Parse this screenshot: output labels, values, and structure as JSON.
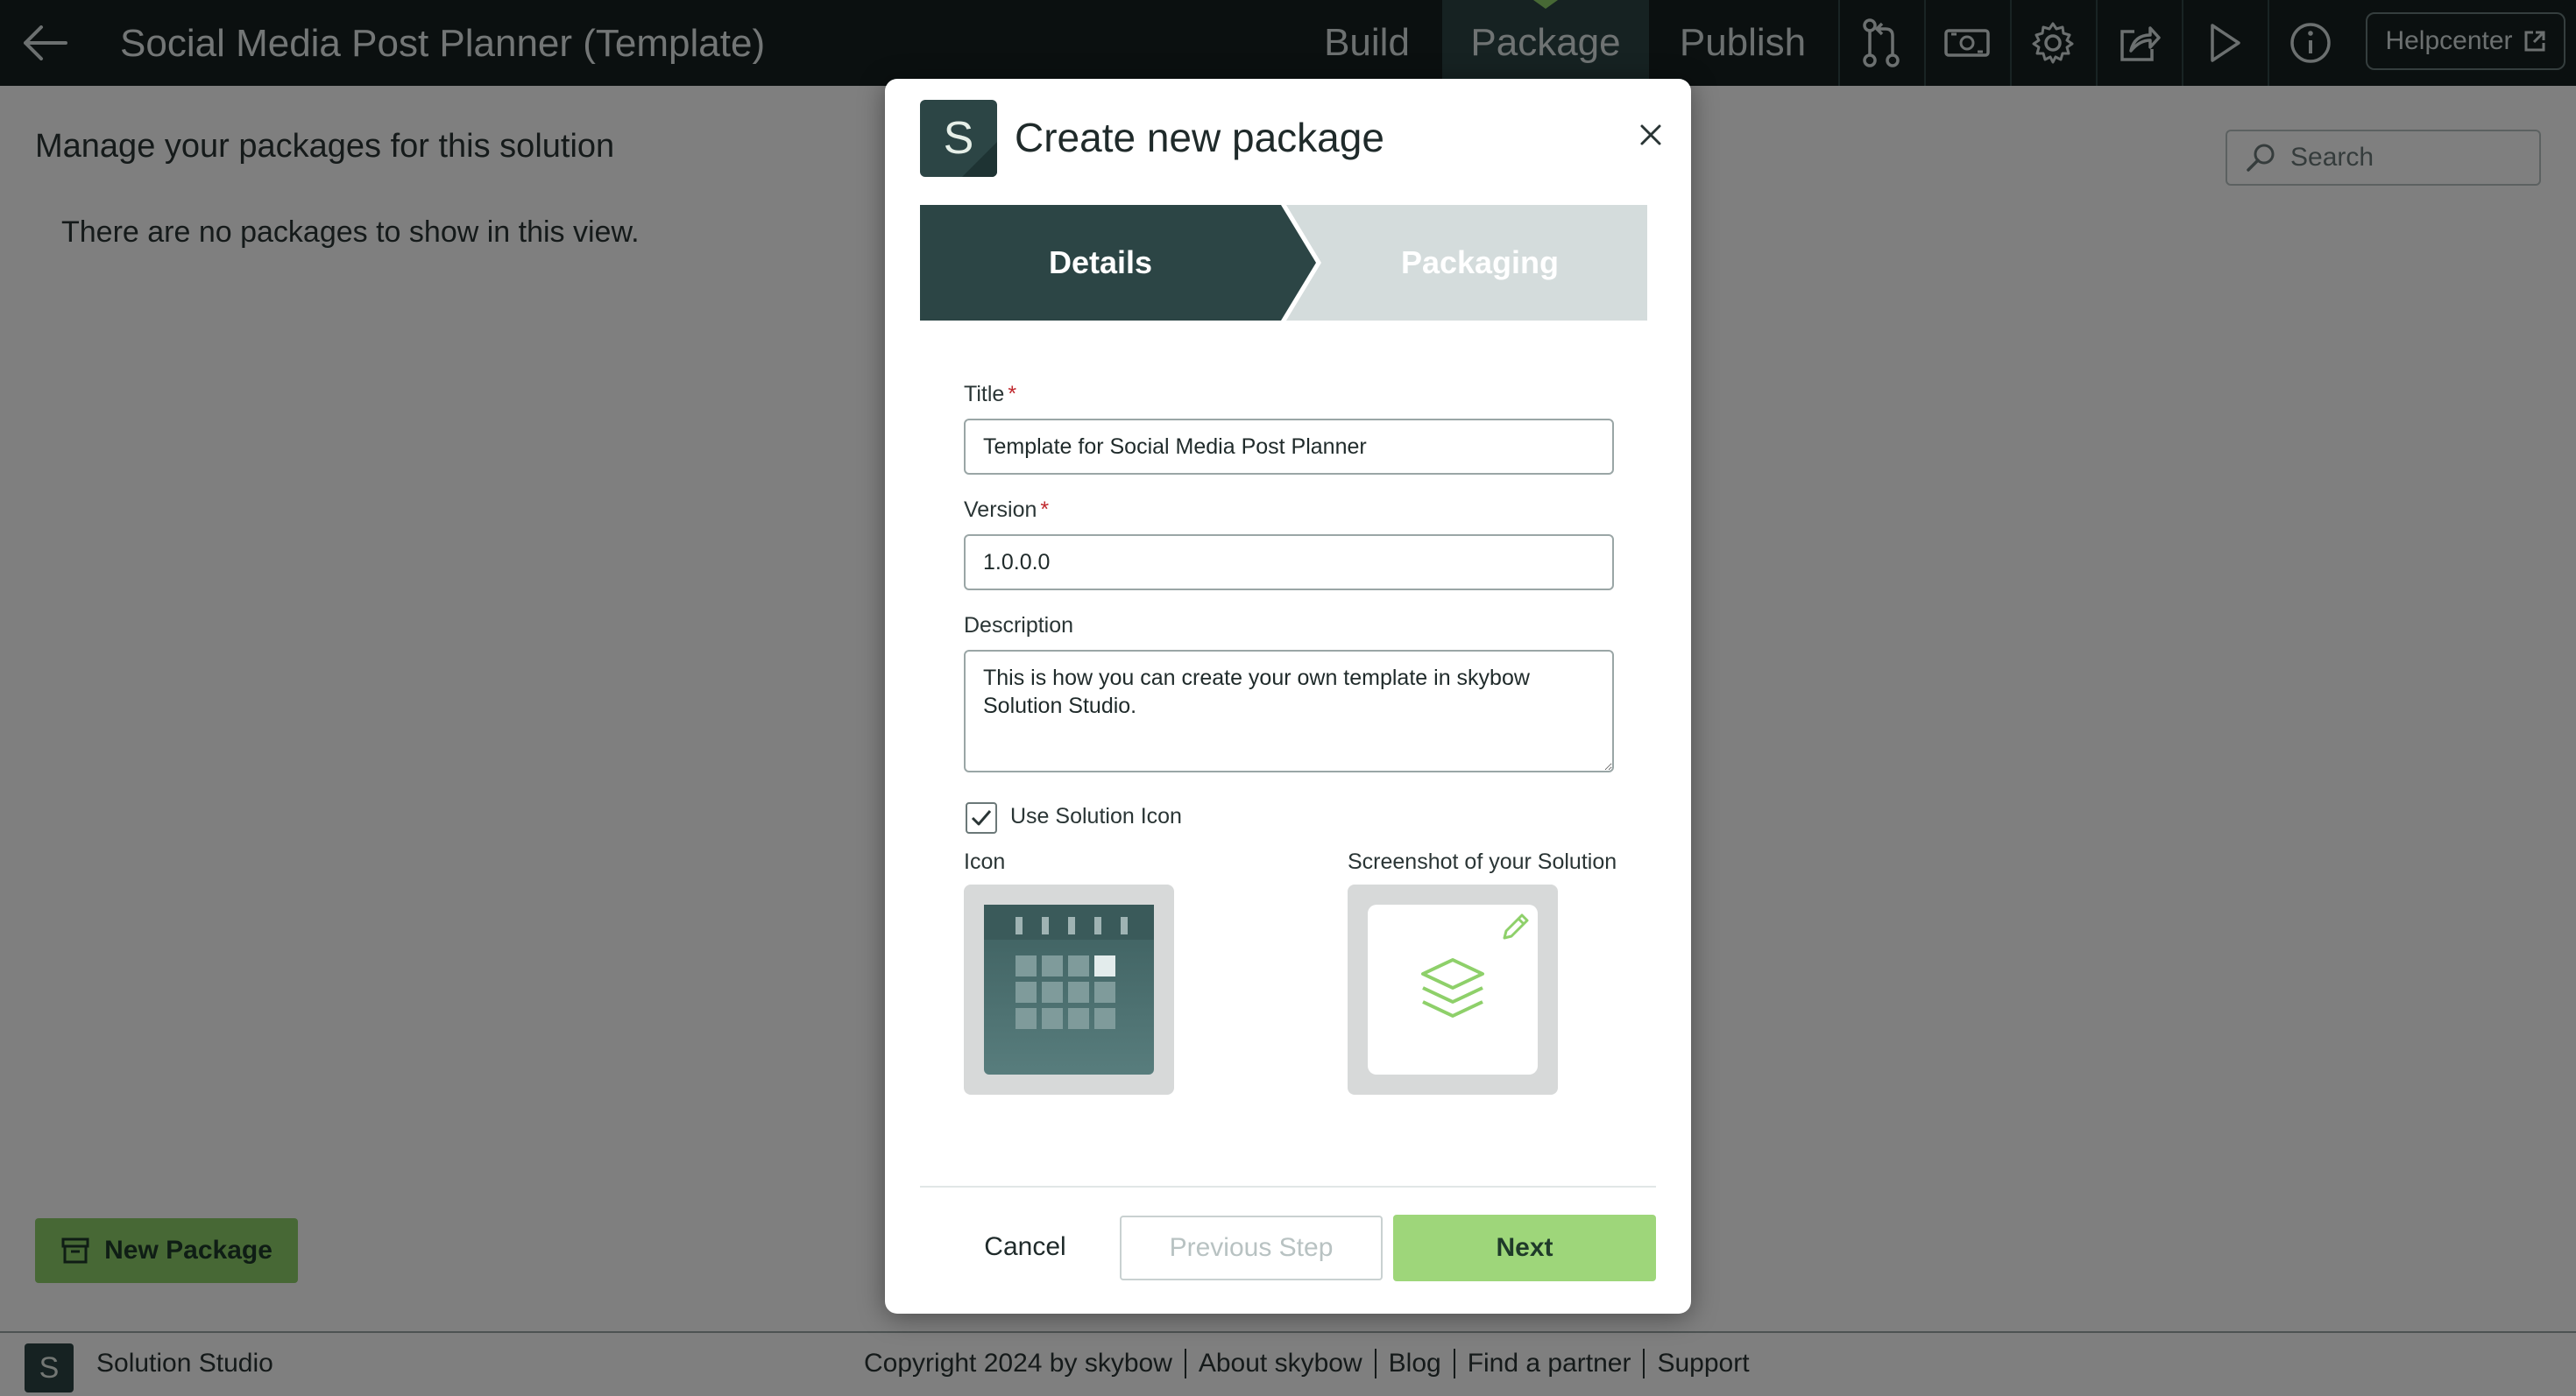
{
  "header": {
    "back_icon": "arrow-left-icon",
    "app_title": "Social Media Post Planner (Template)",
    "tabs": [
      {
        "label": "Build"
      },
      {
        "label": "Package",
        "active": true
      },
      {
        "label": "Publish"
      }
    ],
    "tools": [
      {
        "icon": "branch-compare-icon"
      },
      {
        "icon": "money-icon"
      },
      {
        "icon": "gear-icon"
      },
      {
        "icon": "share-icon"
      },
      {
        "icon": "play-icon"
      },
      {
        "icon": "info-icon"
      }
    ],
    "helpcenter_label": "Helpcenter",
    "helpcenter_icon": "external-link-icon"
  },
  "main": {
    "heading": "Manage your packages for this solution",
    "empty_message": "There are no packages to show in this view.",
    "search_placeholder": "Search",
    "new_package_label": "New Package"
  },
  "footer": {
    "logo_letter": "S",
    "brand": "Solution Studio",
    "links": [
      "Copyright 2024 by skybow",
      "About skybow",
      "Blog",
      "Find a partner",
      "Support"
    ]
  },
  "modal": {
    "logo_letter": "S",
    "title": "Create new package",
    "steps": {
      "details": "Details",
      "packaging": "Packaging"
    },
    "fields": {
      "title_label": "Title",
      "title_value": "Template for Social Media Post Planner",
      "version_label": "Version",
      "version_value": "1.0.0.0",
      "description_label": "Description",
      "description_value": "This is how you can create your own template in skybow Solution Studio.",
      "required_mark": "*"
    },
    "use_solution_icon_label": "Use Solution Icon",
    "use_solution_icon_checked": true,
    "icon_label": "Icon",
    "screenshot_label": "Screenshot of your Solution",
    "buttons": {
      "cancel": "Cancel",
      "previous": "Previous Step",
      "next": "Next"
    }
  },
  "colors": {
    "topbar": "#162121",
    "active_tab": "#2c4545",
    "accent_green": "#8ed06a",
    "step_inactive": "#d4dcdc"
  }
}
